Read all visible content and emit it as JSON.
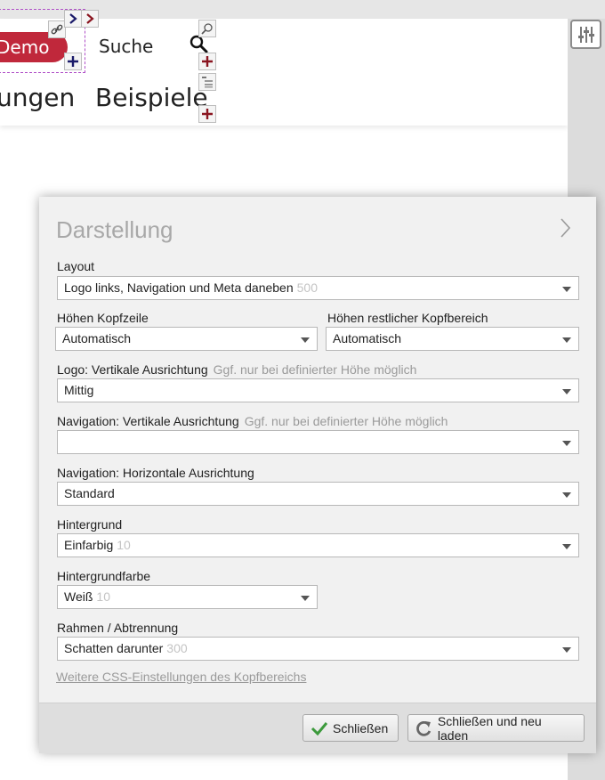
{
  "header": {
    "demo_label": "Demo",
    "search_label": "Suche",
    "nav_items": [
      "ungen",
      "Beispiele"
    ]
  },
  "panel": {
    "title": "Darstellung",
    "fields": {
      "layout": {
        "label": "Layout",
        "value": "Logo links, Navigation und Meta daneben",
        "hint_value": "500"
      },
      "hoehe_kopfzeile": {
        "label": "Höhen Kopfzeile",
        "value": "Automatisch"
      },
      "hoehe_rest": {
        "label": "Höhen restlicher Kopfbereich",
        "value": "Automatisch"
      },
      "logo_vertikal": {
        "label": "Logo: Vertikale Ausrichtung",
        "hint": "Ggf. nur bei definierter Höhe möglich",
        "value": "Mittig"
      },
      "nav_vertikal": {
        "label": "Navigation: Vertikale Ausrichtung",
        "hint": "Ggf. nur bei definierter Höhe möglich",
        "value": ""
      },
      "nav_horizontal": {
        "label": "Navigation: Horizontale Ausrichtung",
        "value": "Standard"
      },
      "hintergrund": {
        "label": "Hintergrund",
        "value": "Einfarbig",
        "hint_value": "10"
      },
      "hintergrundfarbe": {
        "label": "Hintergrundfarbe",
        "value": "Weiß",
        "hint_value": "10"
      },
      "rahmen": {
        "label": "Rahmen / Abtrennung",
        "value": "Schatten darunter",
        "hint_value": "300"
      }
    },
    "more_link": "Weitere CSS-Einstellungen des Kopfbereichs",
    "buttons": {
      "close": "Schließen",
      "close_reload": "Schließen und neu laden"
    }
  },
  "colors": {
    "demo_red": "#c0283b",
    "edit_dashed": "#b050c8",
    "check_green": "#3c9a3c",
    "tool_plus_red": "#8a1520",
    "tool_plus_navy": "#1b1b6a"
  }
}
